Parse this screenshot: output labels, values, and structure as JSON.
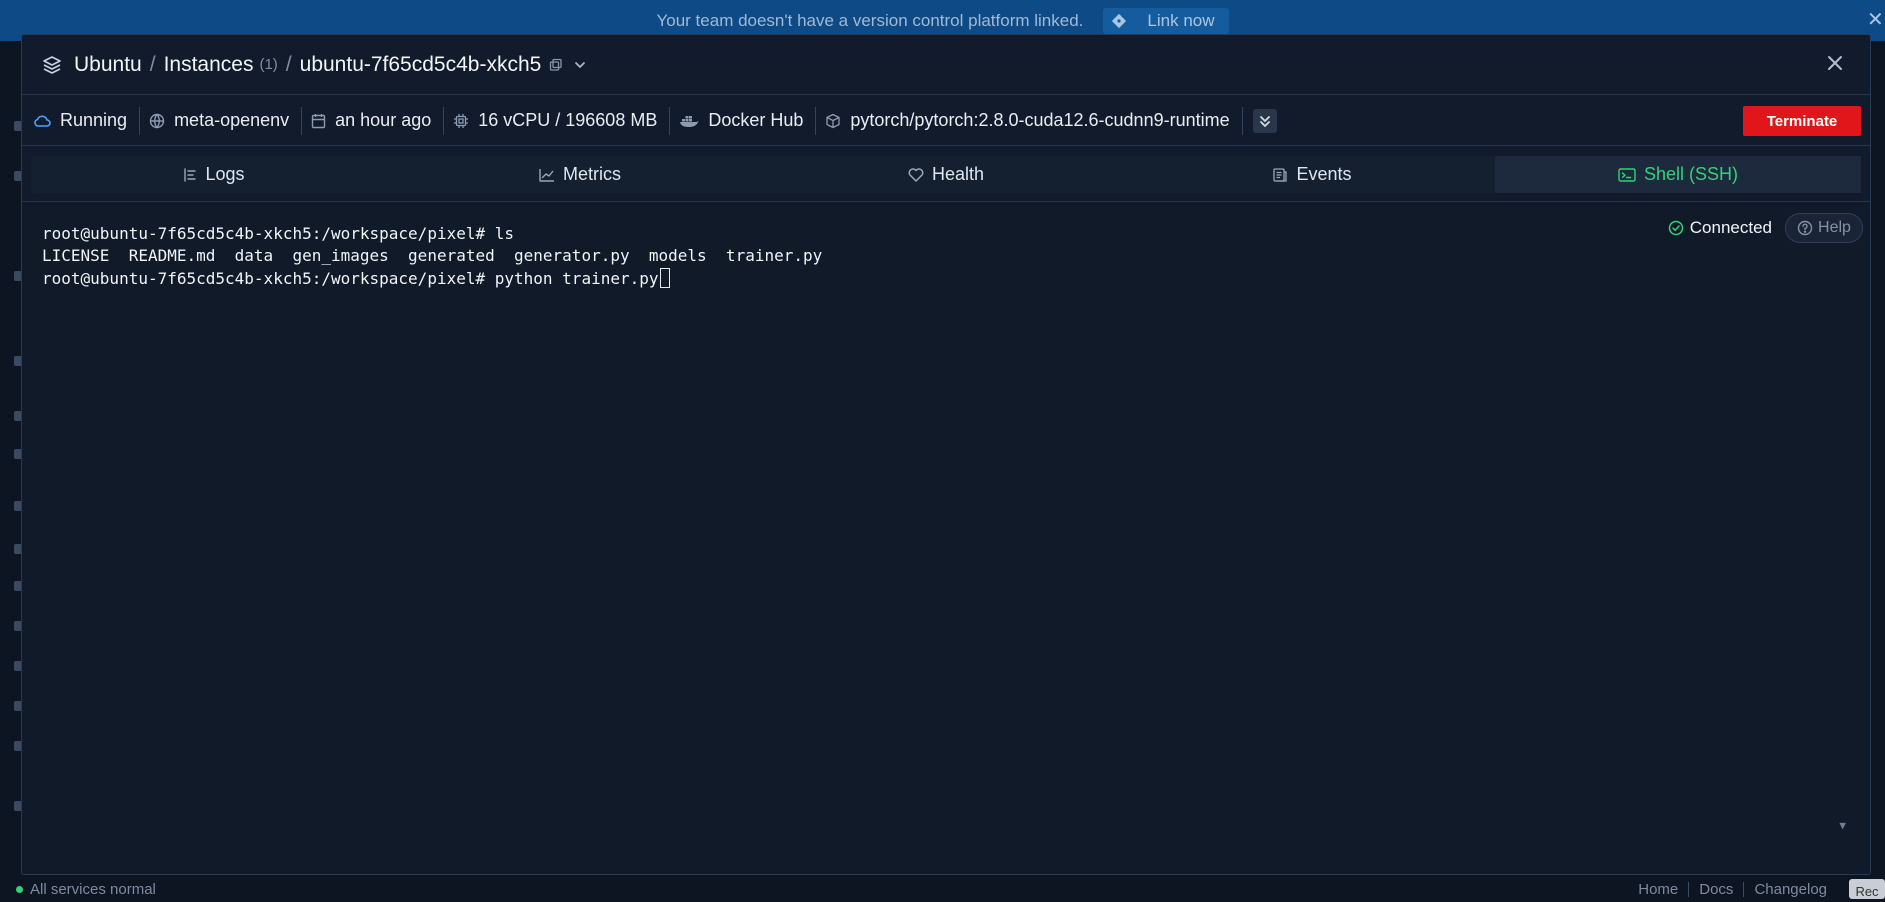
{
  "banner": {
    "message": "Your team doesn't have a version control platform linked.",
    "link_label": "Link now"
  },
  "header": {
    "crumbs": [
      "Ubuntu",
      "Instances",
      "ubuntu-7f65cd5c4b-xkch5"
    ],
    "separator": "/",
    "instances_count": "(1)"
  },
  "info": {
    "status": "Running",
    "network": "meta-openenv",
    "created": "an hour ago",
    "resources": "16 vCPU / 196608 MB",
    "registry": "Docker Hub",
    "image": "pytorch/pytorch:2.8.0-cuda12.6-cudnn9-runtime",
    "terminate_label": "Terminate"
  },
  "tabs": [
    {
      "label": "Logs",
      "icon": "logs-icon"
    },
    {
      "label": "Metrics",
      "icon": "chart-line-icon"
    },
    {
      "label": "Health",
      "icon": "heart-icon"
    },
    {
      "label": "Events",
      "icon": "events-icon"
    },
    {
      "label": "Shell (SSH)",
      "icon": "terminal-icon",
      "active": true
    }
  ],
  "terminal": {
    "lines": [
      "root@ubuntu-7f65cd5c4b-xkch5:/workspace/pixel# ls",
      "LICENSE  README.md  data  gen_images  generated  generator.py  models  trainer.py",
      "root@ubuntu-7f65cd5c4b-xkch5:/workspace/pixel# python trainer.py"
    ],
    "connection": "Connected",
    "help_label": "Help"
  },
  "footer": {
    "status": "All services normal",
    "links": [
      "Home",
      "Docs",
      "Changelog"
    ],
    "rec_label": "Rec"
  },
  "colors": {
    "accent_green": "#34d17a",
    "terminate_red": "#e0161b",
    "banner_blue": "#0e4a86",
    "running_blue": "#4aa3ff"
  }
}
